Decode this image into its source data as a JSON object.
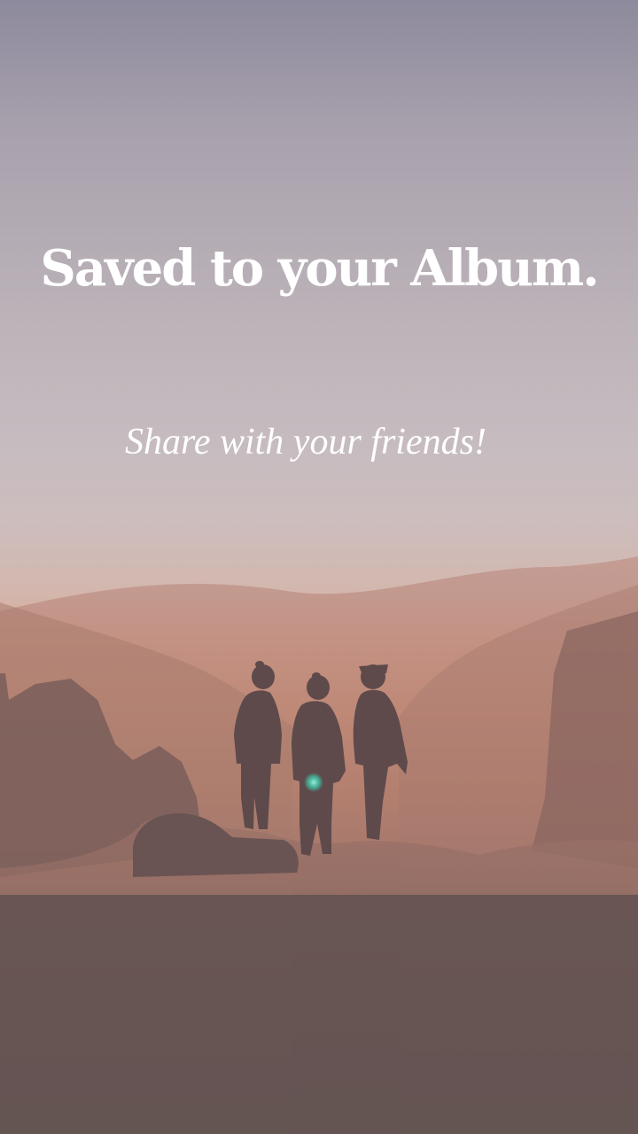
{
  "screen": {
    "headline": "Saved to your Album.",
    "subheading": "Share with your friends!"
  },
  "background": {
    "subject": "three-people-silhouette-on-mountain-at-sunset"
  }
}
